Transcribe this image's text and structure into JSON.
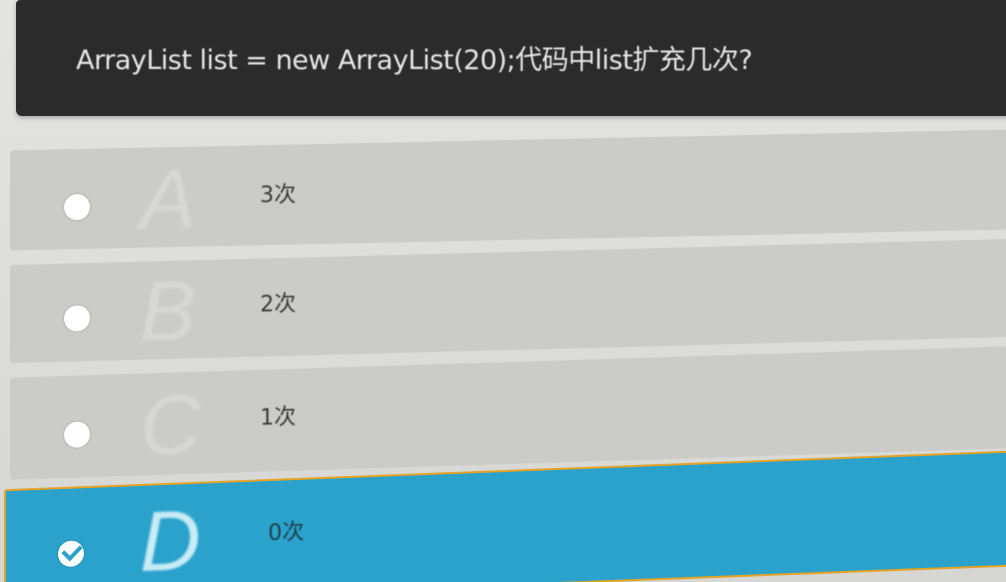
{
  "question": {
    "text": "ArrayList list = new ArrayList(20);代码中list扩充几次?"
  },
  "options": [
    {
      "letter": "A",
      "text": "3次",
      "selected": false
    },
    {
      "letter": "B",
      "text": "2次",
      "selected": false
    },
    {
      "letter": "C",
      "text": "1次",
      "selected": false
    },
    {
      "letter": "D",
      "text": "0次",
      "selected": true
    }
  ],
  "colors": {
    "question_bg": "#2b2b2b",
    "option_bg": "#cbcbc8",
    "selected_bg": "#2aa2cc",
    "selected_border": "#e3a327"
  },
  "icons": {
    "unselected": "radio-empty-icon",
    "selected": "check-circle-icon"
  }
}
